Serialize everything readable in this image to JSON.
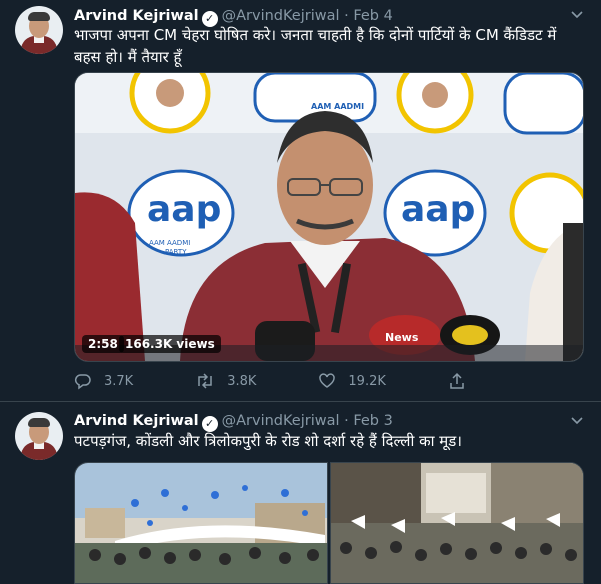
{
  "tweets": [
    {
      "name": "Arvind Kejriwal",
      "handle": "@ArvindKejriwal",
      "separator": "·",
      "date": "Feb 4",
      "text": "भाजपा अपना CM चेहरा घोषित करे। जनता चाहती है कि दोनों पार्टियों के CM कैंडिडट में बहस हो। मैं तैयार हूँ",
      "video": {
        "duration": "2:58",
        "views": "166.3K views",
        "logo_text": "aap",
        "logo_sub": "AAM AADMI PARTY",
        "mic_label": "News"
      },
      "replies": "3.7K",
      "retweets": "3.8K",
      "likes": "19.2K"
    },
    {
      "name": "Arvind Kejriwal",
      "handle": "@ArvindKejriwal",
      "separator": "·",
      "date": "Feb 3",
      "text": "पटपड़गंज, कोंडली और त्रिलोकपुरी के रोड शो दर्शा रहे हैं दिल्ली का मूड।"
    }
  ],
  "colors": {
    "background": "#15202b",
    "border": "#38444d",
    "muted": "#8899a6",
    "text": "#ffffff",
    "jacket": "#8b2e35"
  },
  "icons": [
    "chevron-down-icon",
    "verified-badge-icon",
    "reply-icon",
    "retweet-icon",
    "like-icon",
    "share-icon",
    "play-icon"
  ]
}
